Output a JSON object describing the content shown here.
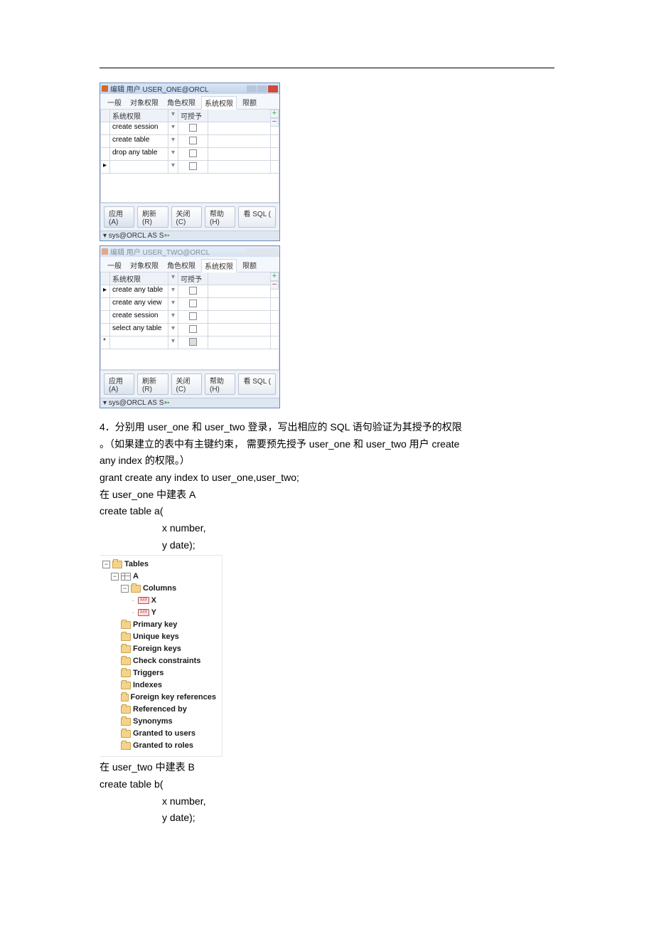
{
  "dialog1": {
    "title": "编辑 用户 USER_ONE@ORCL",
    "tabs": [
      "一般",
      "对象权限",
      "角色权限",
      "系统权限",
      "限额"
    ],
    "active_tab": 3,
    "headers": {
      "col_priv": "系统权限",
      "col_grant": "可授予"
    },
    "rows": [
      {
        "name": "create session"
      },
      {
        "name": "create table"
      },
      {
        "name": "drop any table"
      },
      {
        "name": ""
      }
    ],
    "footer": {
      "apply": "应用(A)",
      "refresh": "刷新(R)",
      "close": "关闭(C)",
      "help": "帮助(H)",
      "viewsql": "看 SQL ("
    },
    "status_prefix": "▾ sys@ORCL AS S",
    "status_suffix": "➳"
  },
  "dialog2": {
    "title": "编辑 用户 USER_TWO@ORCL",
    "tabs": [
      "一般",
      "对象权限",
      "角色权限",
      "系统权限",
      "限额"
    ],
    "active_tab": 3,
    "headers": {
      "col_priv": "系统权限",
      "col_grant": "可授予"
    },
    "rows": [
      {
        "name": "create any table"
      },
      {
        "name": "create any view"
      },
      {
        "name": "create session"
      },
      {
        "name": "select any table"
      },
      {
        "name": ""
      }
    ],
    "footer": {
      "apply": "应用(A)",
      "refresh": "刷新(R)",
      "close": "关闭(C)",
      "help": "帮助(H)",
      "viewsql": "看 SQL ("
    },
    "status_prefix": "▾ sys@ORCL AS S",
    "status_suffix": "➳"
  },
  "text": {
    "p1": "4．分别用 user_one 和 user_two 登录，写出相应的 SQL 语句验证为其授予的权限",
    "p2": "。（如果建立的表中有主键约束，  需要预先授予 user_one 和 user_two 用户 create",
    "p3": "any index 的权限。）",
    "p4": "grant create any index to user_one,user_two;",
    "p5": "在 user_one 中建表 A",
    "p6": "create table a(",
    "p7": "x number,",
    "p8": "y date);",
    "p9": "在 user_two 中建表 B",
    "p10": "create table b(",
    "p11": "x number,",
    "p12": "y date);"
  },
  "tree": {
    "root": "Tables",
    "table": "A",
    "columns_label": "Columns",
    "cols": [
      "X",
      "Y"
    ],
    "items": [
      "Primary key",
      "Unique keys",
      "Foreign keys",
      "Check constraints",
      "Triggers",
      "Indexes",
      "Foreign key references",
      "Referenced by",
      "Synonyms",
      "Granted to users",
      "Granted to roles"
    ]
  }
}
